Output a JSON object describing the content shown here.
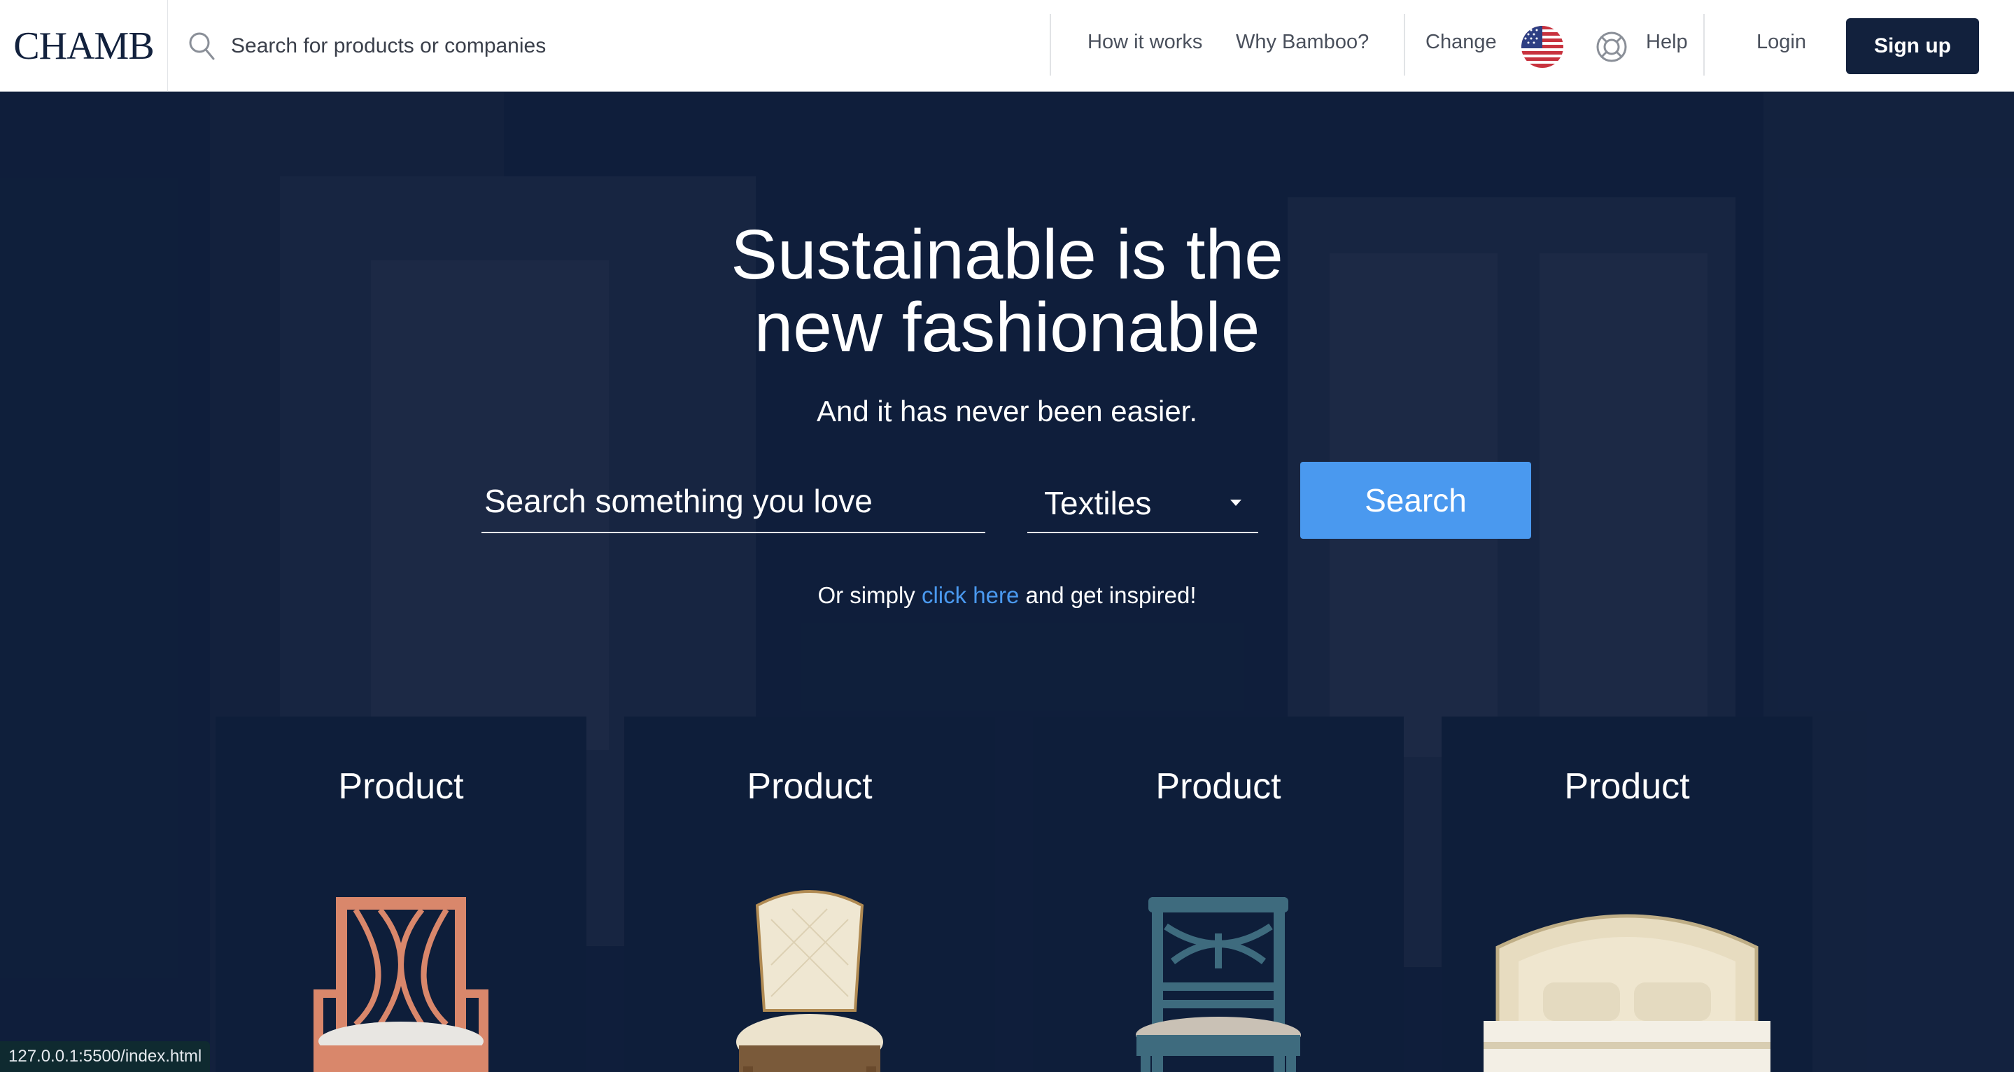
{
  "header": {
    "logo_text": "CHAMB",
    "search_placeholder": "Search for products or companies",
    "nav": {
      "how_it_works": "How it works",
      "why_bamboo": "Why Bamboo?",
      "change": "Change",
      "help": "Help",
      "login": "Login",
      "signup": "Sign up"
    }
  },
  "hero": {
    "title_line1": "Sustainable is the",
    "title_line2": "new fashionable",
    "subtitle": "And it has never been easier.",
    "search_placeholder": "Search something you love",
    "category_selected": "Textiles",
    "search_button": "Search",
    "inspire_prefix": "Or simply ",
    "inspire_link": "click here",
    "inspire_suffix": " and get inspired!"
  },
  "products": [
    {
      "title": "Product",
      "image": "orange-armchair"
    },
    {
      "title": "Product",
      "image": "upholstered-chair"
    },
    {
      "title": "Product",
      "image": "blue-wooden-chair"
    },
    {
      "title": "Product",
      "image": "cream-bed"
    }
  ],
  "status_bar": {
    "url": "127.0.0.1:5500/index.html"
  },
  "colors": {
    "navy": "#12213d",
    "accent": "#4a99ef",
    "card": "#0e1e3a"
  }
}
